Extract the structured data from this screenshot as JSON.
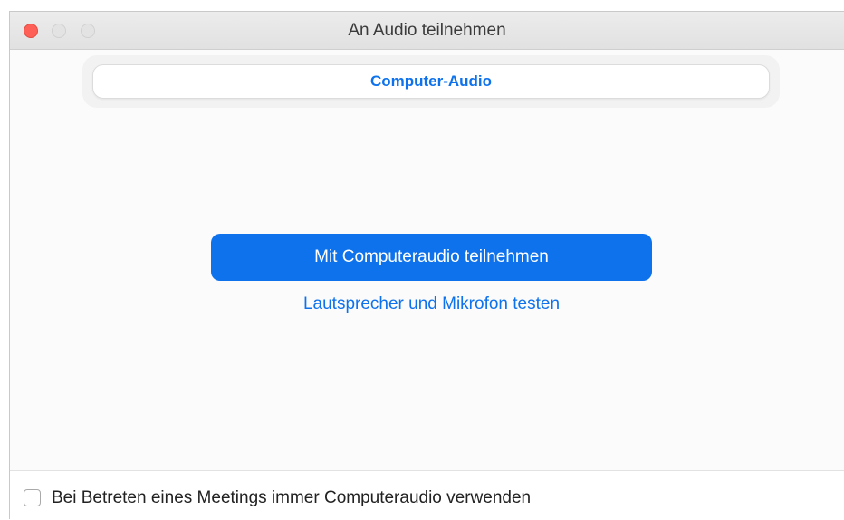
{
  "window": {
    "title": "An Audio teilnehmen"
  },
  "tabs": [
    {
      "label": "Computer-Audio",
      "selected": true
    }
  ],
  "main": {
    "join_button_label": "Mit Computeraudio teilnehmen",
    "test_link_label": "Lautsprecher und Mikrofon testen"
  },
  "footer": {
    "checkbox_label": "Bei Betreten eines Meetings immer Computeraudio verwenden",
    "checkbox_checked": false
  },
  "colors": {
    "accent": "#0e72ed",
    "close_button": "#fe5f57"
  }
}
